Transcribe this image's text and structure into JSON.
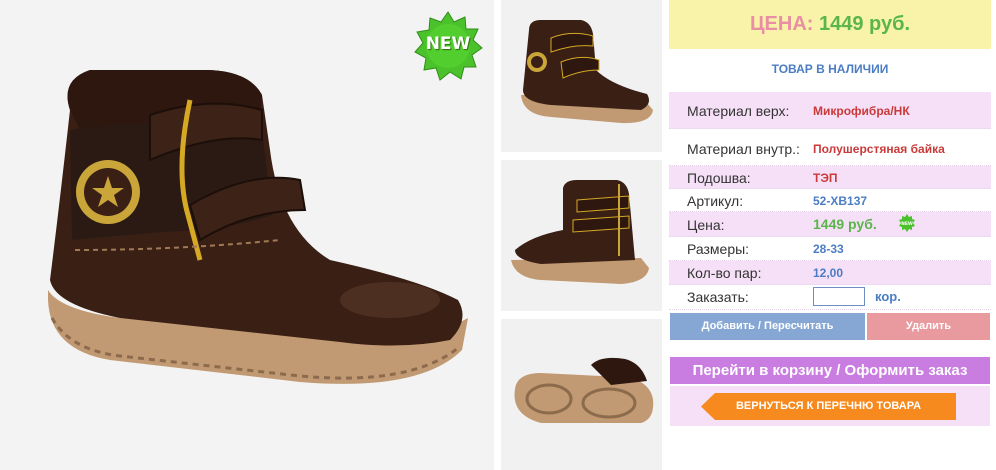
{
  "product_images": {
    "main_alt": "boot main photo",
    "badge_text": "NEW"
  },
  "price_header": {
    "label": "ЦЕНА:",
    "value": "1449 руб."
  },
  "stock_status": "ТОВАР В НАЛИЧИИ",
  "specs": [
    {
      "key": "Материал верх:",
      "value": "Микрофибра/НК"
    },
    {
      "key": "Материал внутр.:",
      "value": "Полушерстяная байка"
    },
    {
      "key": "Подошва:",
      "value": "ТЭП"
    },
    {
      "key": "Артикул:",
      "value": "52-XB137"
    },
    {
      "key": "Цена:",
      "value": "1449 руб."
    },
    {
      "key": "Размеры:",
      "value": "28-33"
    },
    {
      "key": "Кол-во пар:",
      "value": "12,00"
    }
  ],
  "order": {
    "label": "Заказать:",
    "quantity_value": "",
    "unit": "кор."
  },
  "buttons": {
    "add": "Добавить / Пересчитать",
    "delete": "Удалить",
    "cart": "Перейти в корзину / Оформить заказ",
    "back": "ВЕРНУТЬСЯ К ПЕРЕЧНЮ ТОВАРА"
  },
  "colors": {
    "price_label": "#e88fa3",
    "price_value": "#5ab54a",
    "accent_blue": "#4b7dc4",
    "value_red": "#c93a3a",
    "row_pink": "#f6e0f7",
    "header_yellow": "#f8f3a8",
    "cart_purple": "#c97de0",
    "back_orange": "#f78a1e"
  }
}
